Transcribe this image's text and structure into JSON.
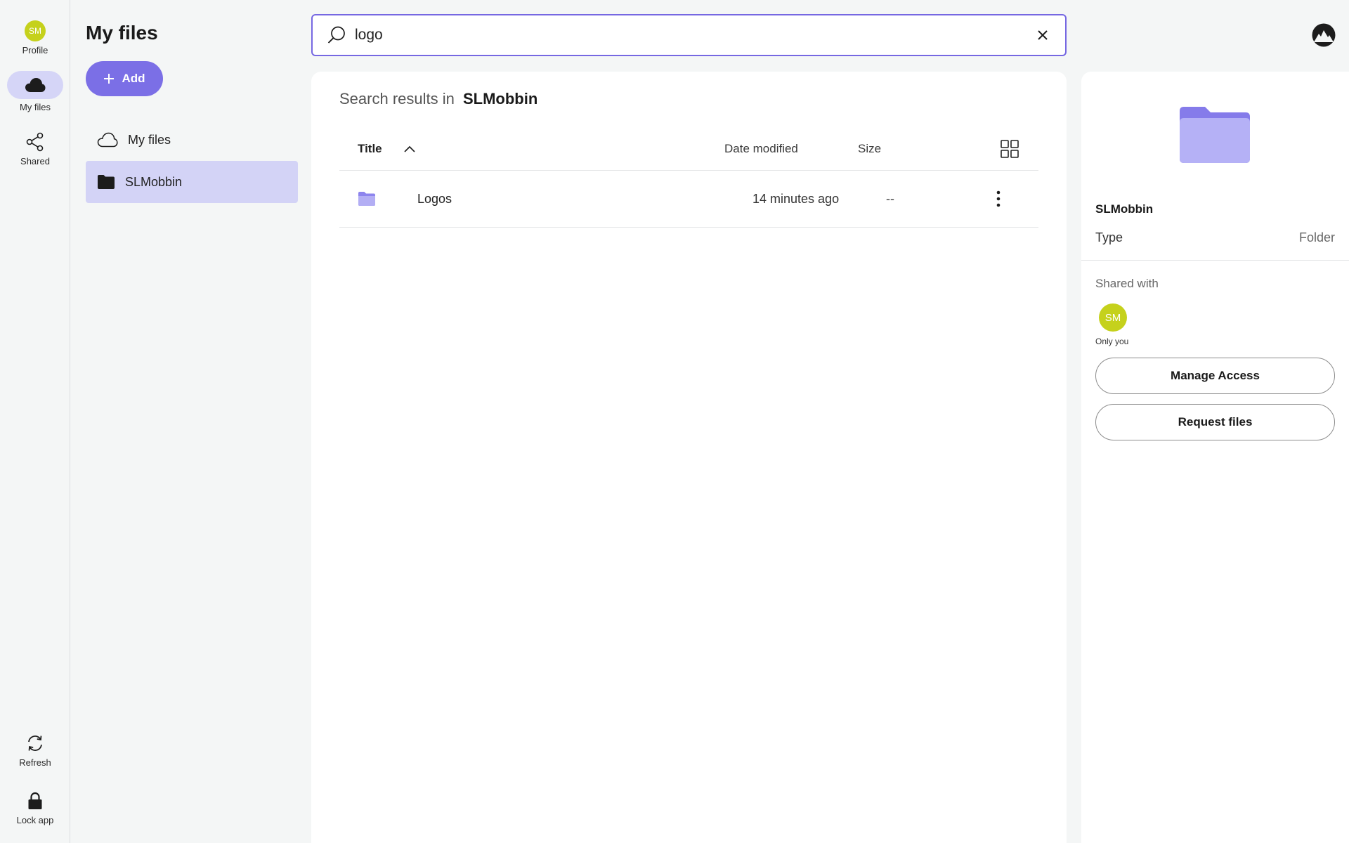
{
  "rail": {
    "profile": {
      "initials": "SM",
      "label": "Profile"
    },
    "my_files": {
      "label": "My files"
    },
    "shared": {
      "label": "Shared"
    },
    "refresh": {
      "label": "Refresh"
    },
    "lock": {
      "label": "Lock app"
    }
  },
  "sidebar": {
    "title": "My files",
    "add_label": "Add",
    "items": [
      {
        "label": "My files",
        "icon": "cloud-outline-icon",
        "active": false
      },
      {
        "label": "SLMobbin",
        "icon": "folder-icon",
        "active": true
      }
    ]
  },
  "search": {
    "value": "logo",
    "placeholder": "Search"
  },
  "results": {
    "prefix": "Search results in",
    "location": "SLMobbin",
    "columns": {
      "title": "Title",
      "date": "Date modified",
      "size": "Size"
    },
    "rows": [
      {
        "name": "Logos",
        "date": "14 minutes ago",
        "size": "--"
      }
    ]
  },
  "details": {
    "name": "SLMobbin",
    "type_label": "Type",
    "type_value": "Folder",
    "shared_with_label": "Shared with",
    "shared_initials": "SM",
    "shared_caption": "Only you",
    "manage_access": "Manage Access",
    "request_files": "Request files"
  },
  "colors": {
    "accent": "#7b6fe6",
    "selection": "#d3d3f6",
    "folder": "#a9a4f2",
    "avatar": "#c5d11c"
  }
}
